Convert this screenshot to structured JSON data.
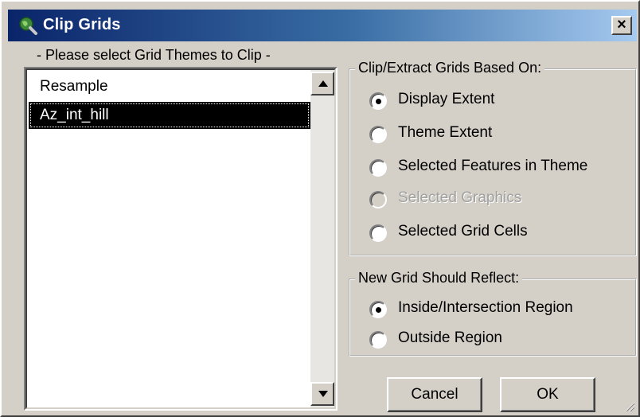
{
  "window": {
    "title": "Clip Grids",
    "close_label": "×"
  },
  "list": {
    "caption": "- Please select Grid Themes to Clip -",
    "items": [
      "Resample",
      "Az_int_hill"
    ],
    "selected_index": 1
  },
  "clip_group": {
    "legend": "Clip/Extract Grids Based On:",
    "options": [
      {
        "label": "Display Extent",
        "checked": true,
        "disabled": false
      },
      {
        "label": "Theme Extent",
        "checked": false,
        "disabled": false
      },
      {
        "label": "Selected Features in Theme",
        "checked": false,
        "disabled": false
      },
      {
        "label": "Selected Graphics",
        "checked": false,
        "disabled": true
      },
      {
        "label": "Selected Grid Cells",
        "checked": false,
        "disabled": false
      }
    ]
  },
  "reflect_group": {
    "legend": "New Grid Should Reflect:",
    "options": [
      {
        "label": "Inside/Intersection Region",
        "checked": true,
        "disabled": false
      },
      {
        "label": "Outside Region",
        "checked": false,
        "disabled": false
      }
    ]
  },
  "buttons": {
    "cancel": "Cancel",
    "ok": "OK"
  },
  "icons": {
    "title": "globe-magnifier-icon",
    "close": "close-icon",
    "scroll_up": "arrow-up-icon",
    "scroll_down": "arrow-down-icon",
    "grip": "resize-grip-icon"
  }
}
